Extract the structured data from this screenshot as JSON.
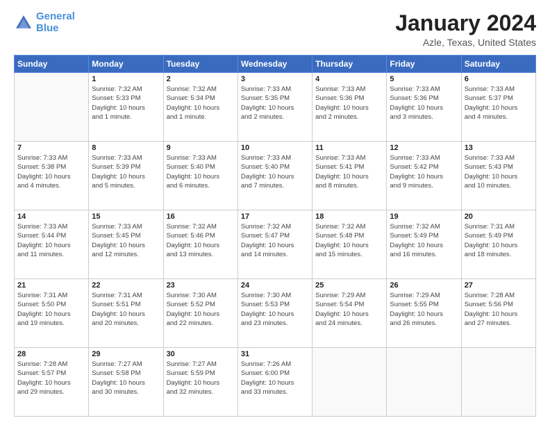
{
  "header": {
    "logo_line1": "General",
    "logo_line2": "Blue",
    "title": "January 2024",
    "subtitle": "Azle, Texas, United States"
  },
  "weekdays": [
    "Sunday",
    "Monday",
    "Tuesday",
    "Wednesday",
    "Thursday",
    "Friday",
    "Saturday"
  ],
  "weeks": [
    [
      {
        "day": "",
        "info": ""
      },
      {
        "day": "1",
        "info": "Sunrise: 7:32 AM\nSunset: 5:33 PM\nDaylight: 10 hours\nand 1 minute."
      },
      {
        "day": "2",
        "info": "Sunrise: 7:32 AM\nSunset: 5:34 PM\nDaylight: 10 hours\nand 1 minute."
      },
      {
        "day": "3",
        "info": "Sunrise: 7:33 AM\nSunset: 5:35 PM\nDaylight: 10 hours\nand 2 minutes."
      },
      {
        "day": "4",
        "info": "Sunrise: 7:33 AM\nSunset: 5:36 PM\nDaylight: 10 hours\nand 2 minutes."
      },
      {
        "day": "5",
        "info": "Sunrise: 7:33 AM\nSunset: 5:36 PM\nDaylight: 10 hours\nand 3 minutes."
      },
      {
        "day": "6",
        "info": "Sunrise: 7:33 AM\nSunset: 5:37 PM\nDaylight: 10 hours\nand 4 minutes."
      }
    ],
    [
      {
        "day": "7",
        "info": "Sunrise: 7:33 AM\nSunset: 5:38 PM\nDaylight: 10 hours\nand 4 minutes."
      },
      {
        "day": "8",
        "info": "Sunrise: 7:33 AM\nSunset: 5:39 PM\nDaylight: 10 hours\nand 5 minutes."
      },
      {
        "day": "9",
        "info": "Sunrise: 7:33 AM\nSunset: 5:40 PM\nDaylight: 10 hours\nand 6 minutes."
      },
      {
        "day": "10",
        "info": "Sunrise: 7:33 AM\nSunset: 5:40 PM\nDaylight: 10 hours\nand 7 minutes."
      },
      {
        "day": "11",
        "info": "Sunrise: 7:33 AM\nSunset: 5:41 PM\nDaylight: 10 hours\nand 8 minutes."
      },
      {
        "day": "12",
        "info": "Sunrise: 7:33 AM\nSunset: 5:42 PM\nDaylight: 10 hours\nand 9 minutes."
      },
      {
        "day": "13",
        "info": "Sunrise: 7:33 AM\nSunset: 5:43 PM\nDaylight: 10 hours\nand 10 minutes."
      }
    ],
    [
      {
        "day": "14",
        "info": "Sunrise: 7:33 AM\nSunset: 5:44 PM\nDaylight: 10 hours\nand 11 minutes."
      },
      {
        "day": "15",
        "info": "Sunrise: 7:33 AM\nSunset: 5:45 PM\nDaylight: 10 hours\nand 12 minutes."
      },
      {
        "day": "16",
        "info": "Sunrise: 7:32 AM\nSunset: 5:46 PM\nDaylight: 10 hours\nand 13 minutes."
      },
      {
        "day": "17",
        "info": "Sunrise: 7:32 AM\nSunset: 5:47 PM\nDaylight: 10 hours\nand 14 minutes."
      },
      {
        "day": "18",
        "info": "Sunrise: 7:32 AM\nSunset: 5:48 PM\nDaylight: 10 hours\nand 15 minutes."
      },
      {
        "day": "19",
        "info": "Sunrise: 7:32 AM\nSunset: 5:49 PM\nDaylight: 10 hours\nand 16 minutes."
      },
      {
        "day": "20",
        "info": "Sunrise: 7:31 AM\nSunset: 5:49 PM\nDaylight: 10 hours\nand 18 minutes."
      }
    ],
    [
      {
        "day": "21",
        "info": "Sunrise: 7:31 AM\nSunset: 5:50 PM\nDaylight: 10 hours\nand 19 minutes."
      },
      {
        "day": "22",
        "info": "Sunrise: 7:31 AM\nSunset: 5:51 PM\nDaylight: 10 hours\nand 20 minutes."
      },
      {
        "day": "23",
        "info": "Sunrise: 7:30 AM\nSunset: 5:52 PM\nDaylight: 10 hours\nand 22 minutes."
      },
      {
        "day": "24",
        "info": "Sunrise: 7:30 AM\nSunset: 5:53 PM\nDaylight: 10 hours\nand 23 minutes."
      },
      {
        "day": "25",
        "info": "Sunrise: 7:29 AM\nSunset: 5:54 PM\nDaylight: 10 hours\nand 24 minutes."
      },
      {
        "day": "26",
        "info": "Sunrise: 7:29 AM\nSunset: 5:55 PM\nDaylight: 10 hours\nand 26 minutes."
      },
      {
        "day": "27",
        "info": "Sunrise: 7:28 AM\nSunset: 5:56 PM\nDaylight: 10 hours\nand 27 minutes."
      }
    ],
    [
      {
        "day": "28",
        "info": "Sunrise: 7:28 AM\nSunset: 5:57 PM\nDaylight: 10 hours\nand 29 minutes."
      },
      {
        "day": "29",
        "info": "Sunrise: 7:27 AM\nSunset: 5:58 PM\nDaylight: 10 hours\nand 30 minutes."
      },
      {
        "day": "30",
        "info": "Sunrise: 7:27 AM\nSunset: 5:59 PM\nDaylight: 10 hours\nand 32 minutes."
      },
      {
        "day": "31",
        "info": "Sunrise: 7:26 AM\nSunset: 6:00 PM\nDaylight: 10 hours\nand 33 minutes."
      },
      {
        "day": "",
        "info": ""
      },
      {
        "day": "",
        "info": ""
      },
      {
        "day": "",
        "info": ""
      }
    ]
  ]
}
